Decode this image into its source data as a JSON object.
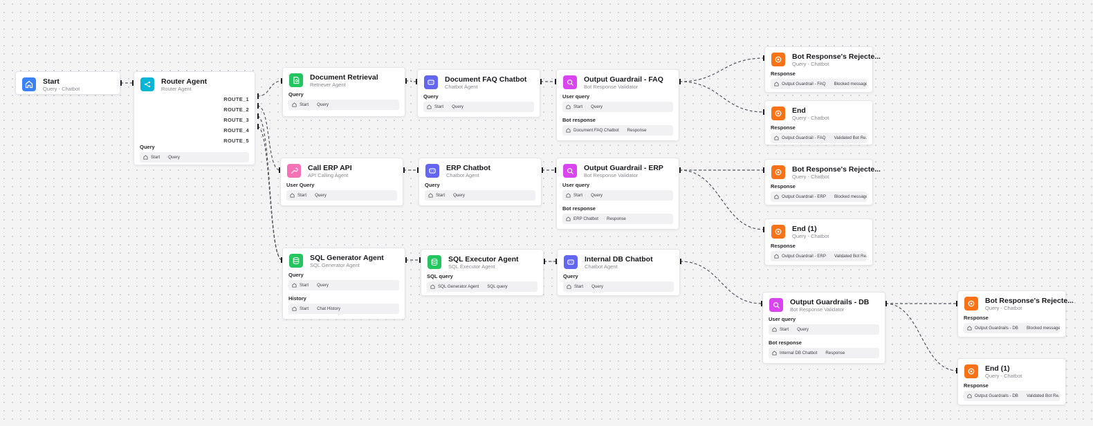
{
  "colors": {
    "blue": "#3b82f6",
    "cyan": "#06b6d4",
    "green": "#22c55e",
    "purple": "#6366f1",
    "magenta": "#d946ef",
    "orange": "#f97316"
  },
  "nodes": {
    "start": {
      "title": "Start",
      "sub": "Query - Chatbot",
      "icon": "home-icon"
    },
    "router": {
      "title": "Router Agent",
      "sub": "Router Agent",
      "routes": [
        "ROUTE_1",
        "ROUTE_2",
        "ROUTE_3",
        "ROUTE_4",
        "ROUTE_5"
      ],
      "inputs": [
        {
          "label": "Query",
          "src": "Start",
          "val": "Query"
        }
      ]
    },
    "docret": {
      "title": "Document Retrieval",
      "sub": "Retriever Agent",
      "inputs": [
        {
          "label": "Query",
          "src": "Start",
          "val": "Query"
        }
      ]
    },
    "docfaq": {
      "title": "Document FAQ Chatbot",
      "sub": "Chatbot Agent",
      "inputs": [
        {
          "label": "Query",
          "src": "Start",
          "val": "Query"
        }
      ]
    },
    "ogfaq": {
      "title": "Output Guardrail - FAQ",
      "sub": "Bot Response Validator",
      "inputs": [
        {
          "label": "User query",
          "src": "Start",
          "val": "Query"
        },
        {
          "label": "Bot response",
          "src": "Document FAQ Chatbot",
          "val": "Response"
        }
      ]
    },
    "rej1": {
      "title": "Bot Response's Rejecte...",
      "sub": "Query - Chatbot",
      "inputs": [
        {
          "label": "Response",
          "src": "Output Guardrail - FAQ",
          "val": "Blocked message"
        }
      ]
    },
    "end1": {
      "title": "End",
      "sub": "Query - Chatbot",
      "inputs": [
        {
          "label": "Response",
          "src": "Output Guardrail - FAQ",
          "val": "Validated Bot Re..."
        }
      ]
    },
    "erpapi": {
      "title": "Call ERP API",
      "sub": "API Calling Agent",
      "inputs": [
        {
          "label": "User Query",
          "src": "Start",
          "val": "Query"
        }
      ]
    },
    "erpbot": {
      "title": "ERP Chatbot",
      "sub": "Chatbot Agent",
      "inputs": [
        {
          "label": "Query",
          "src": "Start",
          "val": "Query"
        }
      ]
    },
    "ogerp": {
      "title": "Output Guardrail - ERP",
      "sub": "Bot Response Validator",
      "inputs": [
        {
          "label": "User query",
          "src": "Start",
          "val": "Query"
        },
        {
          "label": "Bot response",
          "src": "ERP Chatbot",
          "val": "Response"
        }
      ]
    },
    "rej2": {
      "title": "Bot Response's Rejecte...",
      "sub": "Query - Chatbot",
      "inputs": [
        {
          "label": "Response",
          "src": "Output Guardrail - ERP",
          "val": "Blocked message"
        }
      ]
    },
    "end2": {
      "title": "End (1)",
      "sub": "Query - Chatbot",
      "inputs": [
        {
          "label": "Response",
          "src": "Output Guardrail - ERP",
          "val": "Validated Bot Re..."
        }
      ]
    },
    "sqlgen": {
      "title": "SQL Generator Agent",
      "sub": "SQL Generator Agent",
      "inputs": [
        {
          "label": "Query",
          "src": "Start",
          "val": "Query"
        },
        {
          "label": "History",
          "src": "Start",
          "val": "Chat History"
        }
      ]
    },
    "sqlexec": {
      "title": "SQL Executor Agent",
      "sub": "SQL Executor Agent",
      "inputs": [
        {
          "label": "SQL query",
          "src": "SQL Generator Agent",
          "val": "SQL query"
        }
      ]
    },
    "dbbot": {
      "title": "Internal DB Chatbot",
      "sub": "Chatbot Agent",
      "inputs": [
        {
          "label": "Query",
          "src": "Start",
          "val": "Query"
        }
      ]
    },
    "ogdb": {
      "title": "Output Guardrails - DB",
      "sub": "Bot Response Validator",
      "inputs": [
        {
          "label": "User query",
          "src": "Start",
          "val": "Query"
        },
        {
          "label": "Bot response",
          "src": "Internal DB Chatbot",
          "val": "Response"
        }
      ]
    },
    "rej3": {
      "title": "Bot Response's Rejecte...",
      "sub": "Query - Chatbot",
      "inputs": [
        {
          "label": "Response",
          "src": "Output Guardrails - DB",
          "val": "Blocked message"
        }
      ]
    },
    "end3": {
      "title": "End (1)",
      "sub": "Query - Chatbot",
      "inputs": [
        {
          "label": "Response",
          "src": "Output Guardrails - DB",
          "val": "Validated Bot Re..."
        }
      ]
    }
  }
}
